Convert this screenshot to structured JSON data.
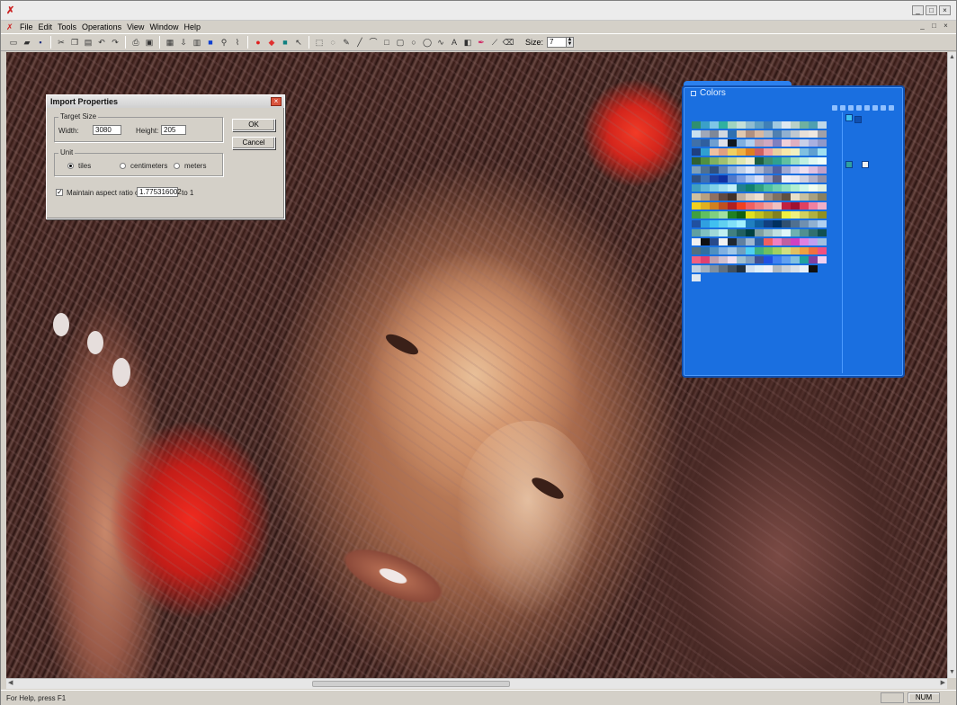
{
  "app": {
    "window_controls": [
      "_",
      "□",
      "×"
    ],
    "doc_controls": [
      "_",
      "□",
      "×"
    ]
  },
  "menu": [
    "File",
    "Edit",
    "Tools",
    "Operations",
    "View",
    "Window",
    "Help"
  ],
  "toolbar": {
    "icons": [
      "new-icon",
      "open-icon",
      "save-icon",
      "sep",
      "cut-icon",
      "copy-icon",
      "paste-icon",
      "undo-icon",
      "redo-icon",
      "sep",
      "print-icon",
      "print-preview-icon",
      "sep",
      "image-icon",
      "import-icon",
      "pattern-icon",
      "color-square-icon",
      "zoom-icon",
      "stitch-icon",
      "sep",
      "red-circle-icon",
      "red-diamond-icon",
      "teal-square-icon",
      "arrow-cursor-icon",
      "sep",
      "select-icon",
      "lasso-icon",
      "pencil-icon",
      "line-icon",
      "polyline-icon",
      "rectangle-icon",
      "square-icon",
      "ellipse-icon",
      "circle-icon",
      "curve-icon",
      "text-icon",
      "fill-icon",
      "eyedropper-color-icon",
      "pipette-icon",
      "eraser-icon"
    ],
    "size_label": "Size:",
    "size_value": "7"
  },
  "dialog": {
    "title": "Import Properties",
    "target_size_label": "Target Size",
    "width_label": "Width:",
    "width_value": "3080",
    "height_label": "Height:",
    "height_value": "205",
    "unit_label": "Unit",
    "units": [
      "tiles",
      "centimeters",
      "meters"
    ],
    "selected_unit": "tiles",
    "aspect_label": "Maintain aspect ratio of",
    "aspect_value": "1.775316002",
    "aspect_suffix": "to 1",
    "ok": "OK",
    "cancel": "Cancel"
  },
  "colors_panel": {
    "title": "Colors",
    "palette": [
      "#2f8f6f",
      "#3aa0c8",
      "#7fc6e6",
      "#2fb0a0",
      "#9fd4c0",
      "#c4e0d8",
      "#8fbcd0",
      "#5fa0c4",
      "#3f80b8",
      "#a0c8e0",
      "#dfe8f0",
      "#b8d0c8",
      "#6fb0a0",
      "#4fa0b0",
      "#c0d8e8",
      "#c8e0f0",
      "#a0a8b8",
      "#7f8898",
      "#d0d8e0",
      "#3070b0",
      "#e0c8b0",
      "#b09080",
      "#d8b8a0",
      "#a8b8c8",
      "#5080b0",
      "#90b0d0",
      "#c0c8d0",
      "#e8e0d8",
      "#f0e8e0",
      "#a0a0a8",
      "#4070a8",
      "#2f5f9f",
      "#6f9fd0",
      "#dfe0e8",
      "#101820",
      "#80b0e0",
      "#b0d0f0",
      "#c0a0b0",
      "#d0a8c0",
      "#8080c0",
      "#f0d0d8",
      "#e0b0c0",
      "#c8d0e8",
      "#a8b0e0",
      "#9098c8",
      "#1f3f7f",
      "#30a0d0",
      "#f0c0a0",
      "#e0a080",
      "#f0d060",
      "#f0b040",
      "#e08020",
      "#d06060",
      "#f0a0a0",
      "#e8d0a0",
      "#f8e8a8",
      "#f0f0c0",
      "#80c0e0",
      "#60a0d0",
      "#a0e0f0",
      "#306030",
      "#509040",
      "#80b060",
      "#a0c070",
      "#c0d890",
      "#e0e8b0",
      "#f0f0d0",
      "#1f5f3f",
      "#3f8f6f",
      "#2fa08f",
      "#60c0a0",
      "#a0e0c0",
      "#c0f0e0",
      "#e0f8f0",
      "#f0fff8",
      "#7fa0b8",
      "#507090",
      "#30507f",
      "#6080b0",
      "#90b0d8",
      "#c0d0e8",
      "#e0e8f8",
      "#b0b8d0",
      "#8090b8",
      "#5060a0",
      "#a0a8d0",
      "#d0d0f0",
      "#f0e0f0",
      "#e0c0e0",
      "#c0a0c8",
      "#305080",
      "#4070b0",
      "#2040a0",
      "#1030a0",
      "#5078c8",
      "#80a0e0",
      "#b0c8f0",
      "#d8e0f8",
      "#a0a0c0",
      "#606080",
      "#f0f0f8",
      "#e8e8f0",
      "#d0d0e0",
      "#b0b0c8",
      "#9090a8",
      "#40a0c0",
      "#60b8d8",
      "#80d0e8",
      "#a0e0f0",
      "#c0f0f8",
      "#208090",
      "#108070",
      "#30a080",
      "#50c0a0",
      "#70d0b0",
      "#90e0c0",
      "#b0f0d0",
      "#d0f8e8",
      "#f0fff0",
      "#e0f0e0",
      "#d0c0a0",
      "#b8a080",
      "#907060",
      "#604840",
      "#403028",
      "#c0b0a0",
      "#e0d0c0",
      "#f0e0d0",
      "#a09080",
      "#807060",
      "#605040",
      "#e8e0c8",
      "#c8c0a0",
      "#a8a080",
      "#888060",
      "#f0d020",
      "#e0b020",
      "#d08020",
      "#c05020",
      "#b02020",
      "#f04020",
      "#f06060",
      "#f08080",
      "#f0a0a0",
      "#f0c0c0",
      "#c02040",
      "#a01030",
      "#e04060",
      "#f080a0",
      "#f0b0c8",
      "#40a040",
      "#60c060",
      "#80d080",
      "#a0e0a0",
      "#208020",
      "#106010",
      "#e0e020",
      "#c0c020",
      "#a0a020",
      "#808020",
      "#f0f040",
      "#f0f080",
      "#d0d060",
      "#b0b040",
      "#909020",
      "#2050a0",
      "#30a0e0",
      "#40c0f0",
      "#60d0f0",
      "#80e0f8",
      "#a0f0ff",
      "#2080c0",
      "#1060a0",
      "#104080",
      "#003060",
      "#305070",
      "#507090",
      "#7090b0",
      "#90b0d0",
      "#b0d0f0",
      "#60a0a0",
      "#80c0c0",
      "#a0d8d8",
      "#c0f0f0",
      "#408080",
      "#206060",
      "#004040",
      "#80a0a0",
      "#a0c0c0",
      "#c0e0e0",
      "#e0f8f8",
      "#70b0b0",
      "#509090",
      "#307070",
      "#105050",
      "#f0f0f0",
      "#101010",
      "#2a4a8a",
      "#f0f0f0",
      "#202830",
      "#6080a0",
      "#a0b8d0",
      "#3060a0",
      "#f06060",
      "#f080c0",
      "#c060a0",
      "#d040c0",
      "#e080e0",
      "#c0a0f0",
      "#a0c0e0",
      "#507080",
      "#3070a0",
      "#5090c0",
      "#80b0e0",
      "#a0c8e8",
      "#70a0c0",
      "#50d0f0",
      "#40b080",
      "#70c060",
      "#a0d060",
      "#d0e080",
      "#e0c060",
      "#f0a040",
      "#f07040",
      "#f05080",
      "#f06080",
      "#e04070",
      "#c0a0b0",
      "#d0c0d0",
      "#f0e0f0",
      "#a0c0d0",
      "#80a0c0",
      "#405090",
      "#2050e0",
      "#4080f0",
      "#60a0f0",
      "#80c0e0",
      "#20a0a0",
      "#8040a0",
      "#f0d0f0",
      "#c0d0e0",
      "#a0b0c0",
      "#8090a0",
      "#607080",
      "#405060",
      "#203040",
      "#d0e0f0",
      "#e0f0f8",
      "#f0f0f8",
      "#b0b8c0",
      "#c8d0d8",
      "#d8e0e8",
      "#e8f0f8",
      "#101010",
      "#1a6fe0",
      "#e0e8f0",
      "#1a6fe0",
      "#1a6fe0",
      "#1a6fe0",
      "#1a6fe0",
      "#1a6fe0",
      "#1a6fe0",
      "#1a6fe0",
      "#1a6fe0",
      "#1a6fe0",
      "#1a6fe0",
      "#1a6fe0",
      "#1a6fe0",
      "#1a6fe0",
      "#1a6fe0"
    ],
    "side_swatches": [
      "#40c0f0",
      "#1050b0",
      "#30a0a0",
      "#f0f0f0"
    ]
  },
  "status": {
    "text": "For Help, press F1",
    "num": "NUM"
  },
  "colors": {
    "accent": "#1a6fe0",
    "chrome": "#d4d0c8"
  }
}
